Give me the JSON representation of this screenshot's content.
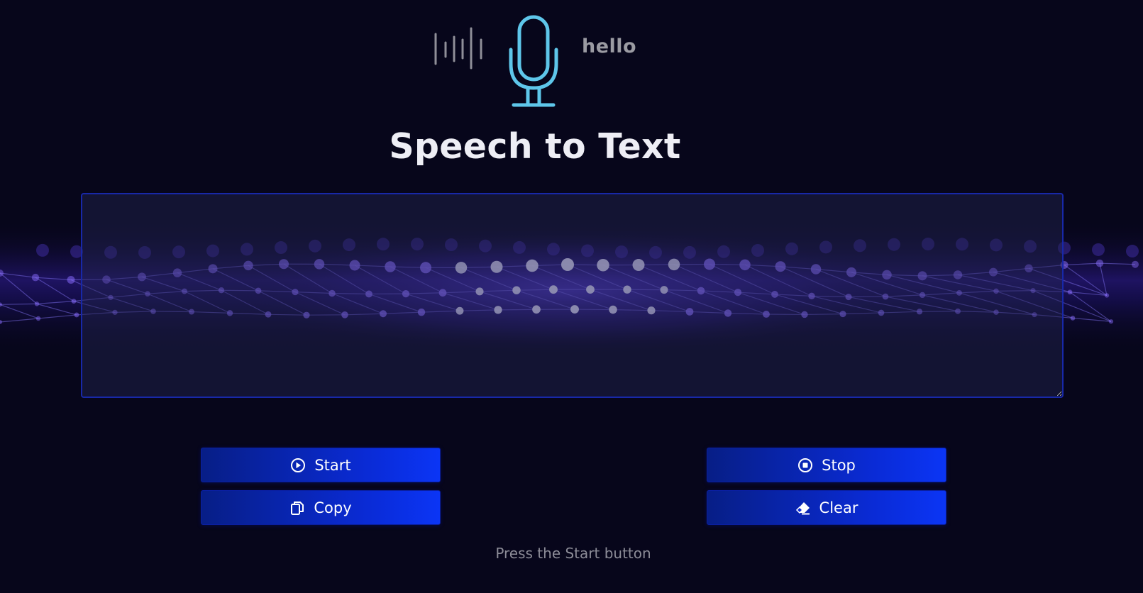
{
  "logo": {
    "word": "hello",
    "icons": [
      "sound-wave-icon",
      "microphone-icon"
    ],
    "mic_color": "#5ec6ea"
  },
  "title": "Speech to Text",
  "textarea": {
    "value": "",
    "placeholder": ""
  },
  "buttons": {
    "start": {
      "label": "Start",
      "icon": "play-circle-icon"
    },
    "stop": {
      "label": "Stop",
      "icon": "stop-circle-icon"
    },
    "copy": {
      "label": "Copy",
      "icon": "copy-icon"
    },
    "clear": {
      "label": "Clear",
      "icon": "eraser-icon"
    }
  },
  "status": "Press the Start button",
  "colors": {
    "background": "#07061b",
    "button_gradient_start": "#071e86",
    "button_gradient_end": "#0b35f5",
    "glow": "#6a4dff"
  }
}
